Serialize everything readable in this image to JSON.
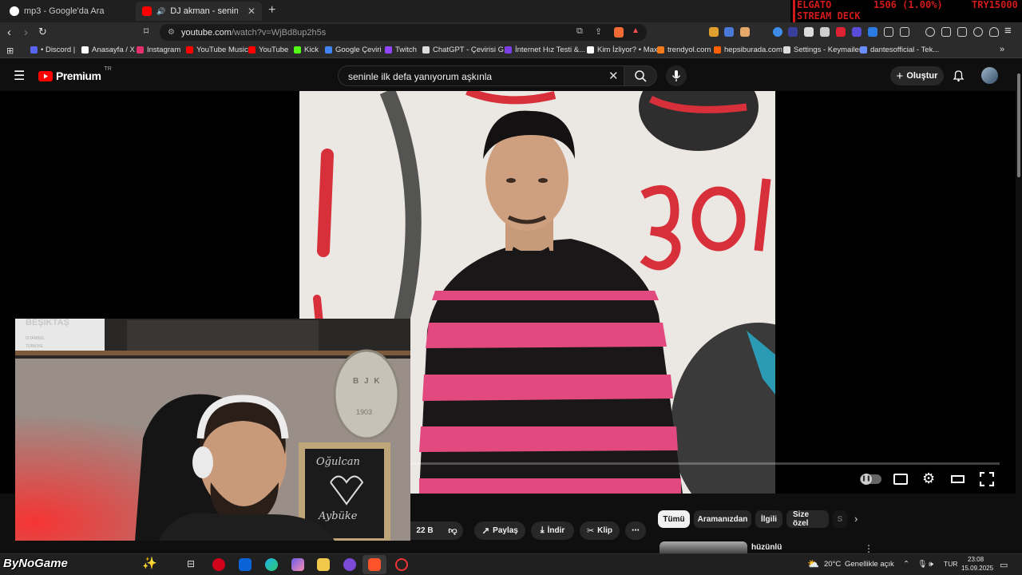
{
  "browser": {
    "tabs": [
      {
        "label": "mp3 - Google'da Ara",
        "active": false
      },
      {
        "label": "DJ akman - seninle ilk defa ya",
        "active": true
      }
    ],
    "url_host": "youtube.com",
    "url_path": "/watch?v=WjBd8up2h5s"
  },
  "overlay": {
    "line1_left": "ELGATO",
    "line1_mid": "1506 (1.00%)",
    "line1_right": "TRY15000",
    "line2": "STREAM DECK"
  },
  "bookmarks": [
    {
      "label": "• Discord |",
      "color": "#5865F2"
    },
    {
      "label": "Anasayfa / X",
      "color": "#ffffff"
    },
    {
      "label": "Instagram",
      "color": "#e1306c"
    },
    {
      "label": "YouTube Music",
      "color": "#ff0000"
    },
    {
      "label": "YouTube",
      "color": "#ff0000"
    },
    {
      "label": "Kick",
      "color": "#53fc18"
    },
    {
      "label": "Google Çeviri",
      "color": "#4285f4"
    },
    {
      "label": "Twitch",
      "color": "#9146ff"
    },
    {
      "label": "ChatGPT - Çevirisi G...",
      "color": "#dddddd"
    },
    {
      "label": "İnternet Hız Testi &...",
      "color": "#7b3fe4"
    },
    {
      "label": "Kim İzliyor? • Max",
      "color": "#ffffff"
    },
    {
      "label": "trendyol.com",
      "color": "#f27a1a"
    },
    {
      "label": "hepsiburada.com",
      "color": "#ff6000"
    },
    {
      "label": "Settings - Keymailer",
      "color": "#dddddd"
    },
    {
      "label": "dantesofficial - Tek...",
      "color": "#6a8dff"
    }
  ],
  "youtube": {
    "logo_text": "Premium",
    "logo_region": "TR",
    "search_value": "seninle ilk defa yanıyorum aşkınla",
    "create_label": "Oluştur",
    "progress_fraction": 0.0
  },
  "actions": {
    "likes": "22 B",
    "share": "Paylaş",
    "download": "İndir",
    "clip": "Klip"
  },
  "chips": [
    "Tümü",
    "Aramanızdan",
    "İlgili",
    "Size özel",
    "S"
  ],
  "related_title": "hüzünlü",
  "webcam": {
    "banner_text": "BEŞİKTAŞ",
    "banner_sub": "İSTANBUL",
    "banner_sub2": "TÜRKİYE",
    "chalk_top": "Oğulcan",
    "chalk_bottom": "Aybüke",
    "emblem": "B J K",
    "emblem_year": "1903"
  },
  "taskbar": {
    "watermark": "ByNoGame",
    "weather": "20°C",
    "weather_desc": "Genellikle açık",
    "lang": "TUR",
    "time": "23:08",
    "date": "15.09.2025"
  }
}
